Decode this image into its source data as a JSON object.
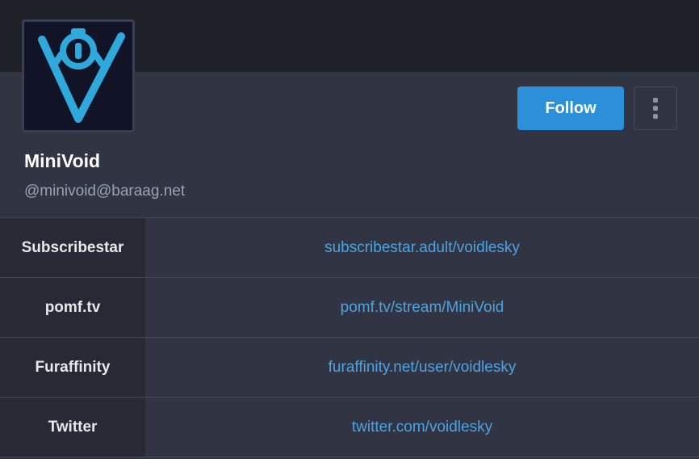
{
  "profile": {
    "display_name": "MiniVoid",
    "handle": "@minivoid@baraag.net",
    "avatar_icon": "minivoid-logo-icon",
    "follow_label": "Follow",
    "more_icon": "vertical-ellipsis-icon"
  },
  "fields": [
    {
      "name": "Subscribestar",
      "value": "subscribestar.adult/voidlesky"
    },
    {
      "name": "pomf.tv",
      "value": "pomf.tv/stream/MiniVoid"
    },
    {
      "name": "Furaffinity",
      "value": "furaffinity.net/user/voidlesky"
    },
    {
      "name": "Twitter",
      "value": "twitter.com/voidlesky"
    }
  ],
  "colors": {
    "accent": "#2b90d9",
    "link": "#4ea2e0",
    "background": "#313543",
    "header": "#1f2129",
    "field_label_bg": "#272a35",
    "avatar_bg": "#111426",
    "logo": "#2fa9dc"
  }
}
